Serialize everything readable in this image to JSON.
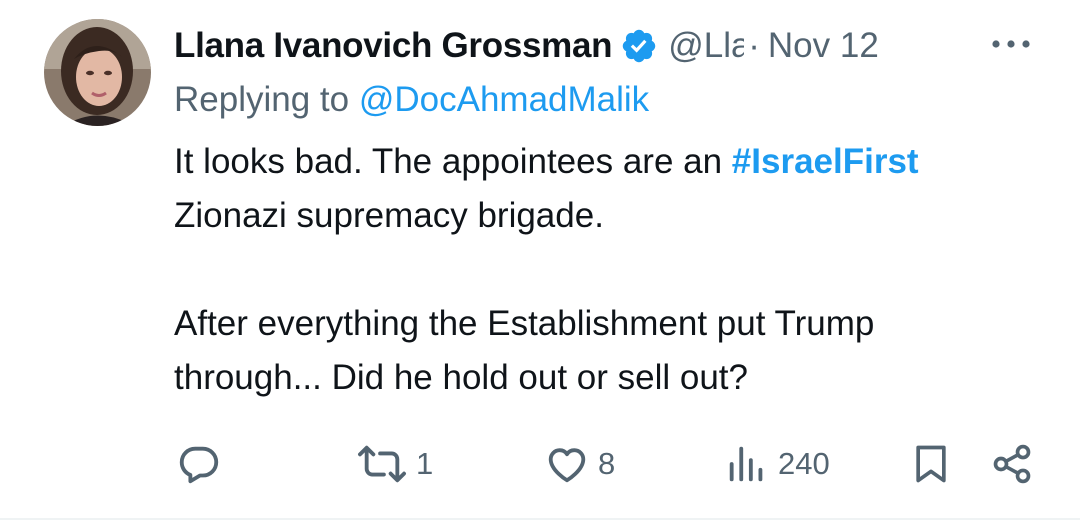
{
  "tweet": {
    "author_name": "Llana Ivanovich Grossman",
    "author_handle": "@Llana",
    "separator": "·",
    "date": "Nov 12",
    "replying_prefix": "Replying to ",
    "replying_to": "@DocAhmadMalik",
    "text_line1_before": "It looks bad. The appointees are an ",
    "hashtag": "#IsraelFirst",
    "text_line2": "Zionazi supremacy brigade.",
    "text_line3": "After everything the Establishment put Trump",
    "text_line4": "through... Did he hold out or sell out?"
  },
  "actions": {
    "reply_icon": "reply-icon",
    "retweet_icon": "retweet-icon",
    "retweet_count": "1",
    "like_icon": "heart-icon",
    "like_count": "8",
    "views_icon": "bar-chart-icon",
    "views_count": "240",
    "bookmark_icon": "bookmark-icon",
    "share_icon": "share-icon"
  },
  "colors": {
    "link": "#1d9bf0",
    "secondary_text": "#536471",
    "primary_text": "#0f1419",
    "verified_badge": "#1d9bf0"
  }
}
